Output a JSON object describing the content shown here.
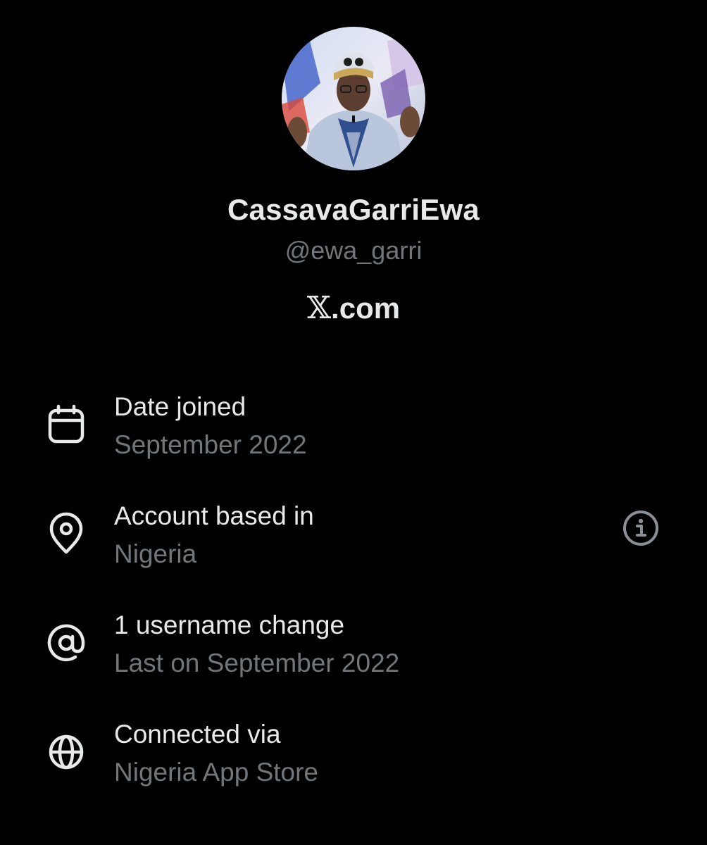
{
  "profile": {
    "display_name": "CassavaGarriEwa",
    "handle": "@ewa_garri",
    "site_mark": "𝕏",
    "site_suffix": ".com"
  },
  "details": [
    {
      "icon": "calendar-icon",
      "title": "Date joined",
      "value": "September 2022"
    },
    {
      "icon": "location-pin-icon",
      "title": "Account based in",
      "value": "Nigeria"
    },
    {
      "icon": "at-sign-icon",
      "title": "1 username change",
      "value": "Last on September 2022"
    },
    {
      "icon": "globe-icon",
      "title": "Connected via",
      "value": "Nigeria App Store"
    }
  ],
  "colors": {
    "background": "#000000",
    "primary_text": "#e7e9ea",
    "secondary_text": "#71767b"
  }
}
